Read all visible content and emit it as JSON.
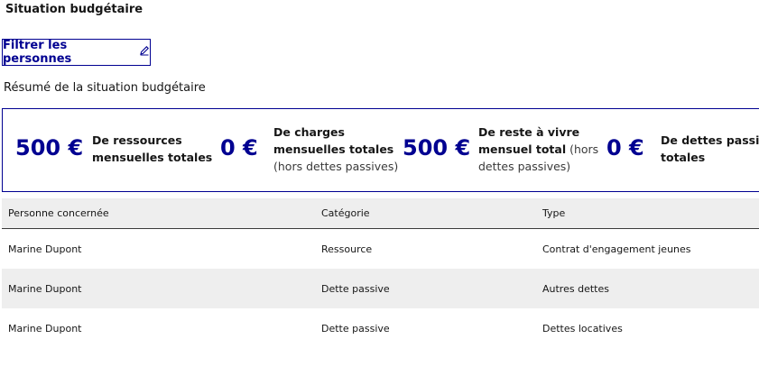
{
  "page": {
    "section_title": "Situation budgétaire",
    "filter_button_label": "Filtrer les personnes",
    "summary_title": "Résumé de la situation budgétaire"
  },
  "summary": [
    {
      "amount": "500 €",
      "line1": "De ressources",
      "line2": "mensuelles totales",
      "line3": ""
    },
    {
      "amount": "0 €",
      "line1": "De charges",
      "line2": "mensuelles totales",
      "line3": "(hors dettes passives)"
    },
    {
      "amount": "500 €",
      "line1": "De reste à vivre",
      "line2_bold": "mensuel total",
      "line2_rest": " (hors",
      "line3": "dettes passives)"
    },
    {
      "amount": "0 €",
      "line1": "De dettes passives",
      "line2": "totales",
      "line3": ""
    }
  ],
  "table": {
    "headers": [
      "Personne concernée",
      "Catégorie",
      "Type"
    ],
    "rows": [
      [
        "Marine Dupont",
        "Ressource",
        "Contrat d'engagement jeunes"
      ],
      [
        "Marine Dupont",
        "Dette passive",
        "Autres dettes"
      ],
      [
        "Marine Dupont",
        "Dette passive",
        "Dettes locatives"
      ]
    ]
  },
  "colors": {
    "accent": "#000091",
    "row_alt": "#eeeeee"
  },
  "icons": {
    "filter_button": "pencil-icon"
  }
}
